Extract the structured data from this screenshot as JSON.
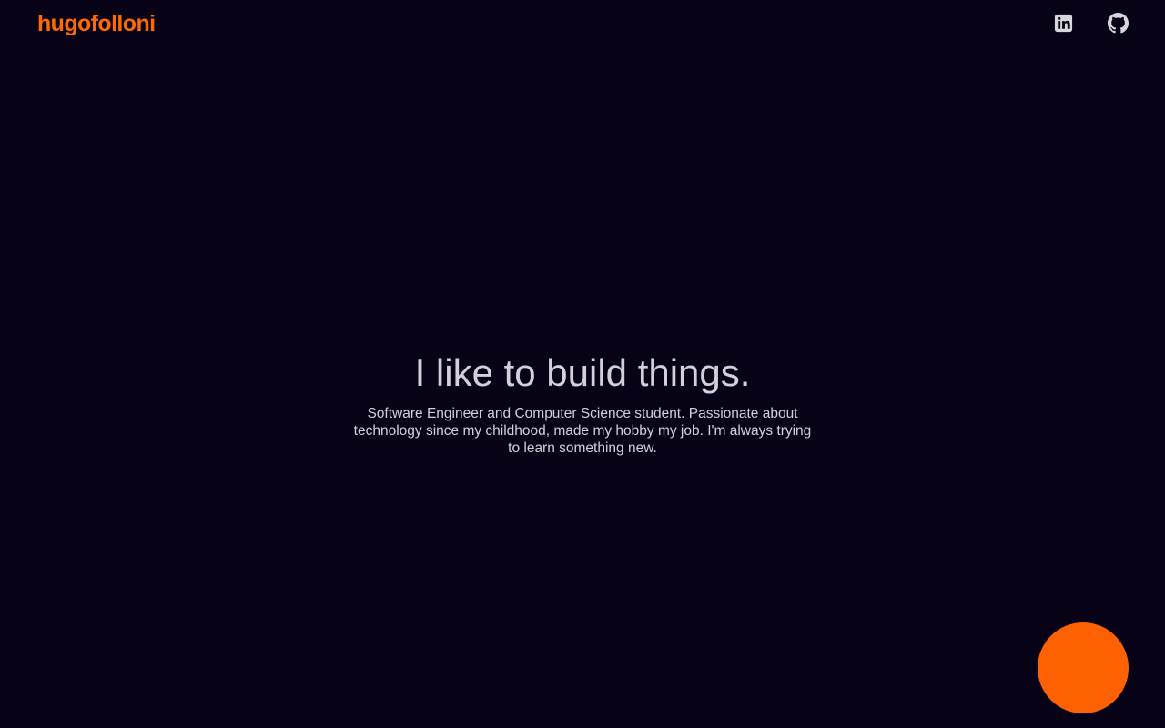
{
  "header": {
    "logo_text": "hugofolloni",
    "social_links": [
      {
        "icon": "linkedin-icon",
        "label": "LinkedIn"
      },
      {
        "icon": "github-icon",
        "label": "GitHub"
      }
    ]
  },
  "hero": {
    "title": "I like to build things.",
    "description": "Software Engineer and Computer Science student. Passionate about technology since my childhood, made my hobby my job. I'm always trying to learn something new."
  },
  "colors": {
    "background": "#070215",
    "accent": "#ff6100",
    "text": "#d3d0db",
    "icon": "#d8d6dd"
  }
}
